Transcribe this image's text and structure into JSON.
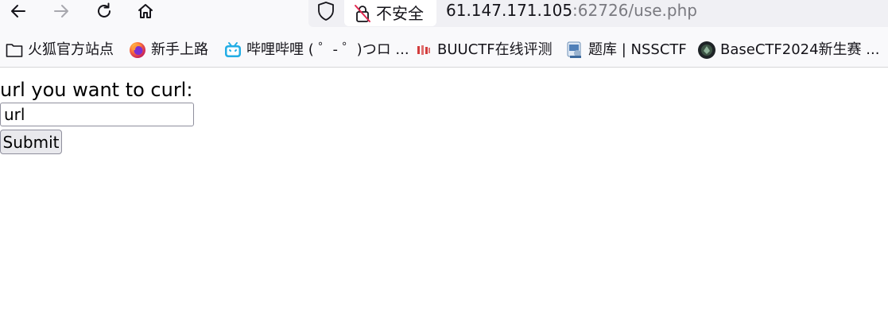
{
  "browser": {
    "nav": {
      "back_icon": "arrow-left-icon",
      "forward_icon": "arrow-right-icon",
      "reload_icon": "reload-icon",
      "home_icon": "home-icon"
    },
    "urlbar": {
      "shield_icon": "shield-icon",
      "security_icon": "insecure-lock-icon",
      "security_label": "不安全",
      "host": "61.147.171.105",
      "rest": ":62726/use.php"
    }
  },
  "bookmarks": [
    {
      "label": "火狐官方站点",
      "icon": "folder-icon"
    },
    {
      "label": "新手上路",
      "icon": "firefox-icon"
    },
    {
      "label": "哔哩哔哩 ( ゜- ゜)つロ ...",
      "icon": "bilibili-icon"
    },
    {
      "label": "BUUCTF在线评测",
      "icon": "buuctf-icon"
    },
    {
      "label": "题库 | NSSCTF",
      "icon": "nssctf-icon"
    },
    {
      "label": "BaseCTF2024新生赛 ...",
      "icon": "basectf-icon"
    }
  ],
  "page": {
    "prompt_label": "url you want to curl:",
    "url_input_value": "url",
    "submit_label": "Submit"
  },
  "colors": {
    "toolbar_bg": "#f9f9fb",
    "urlbar_bg": "#f0f0f4",
    "insecure_red": "#e22850"
  }
}
